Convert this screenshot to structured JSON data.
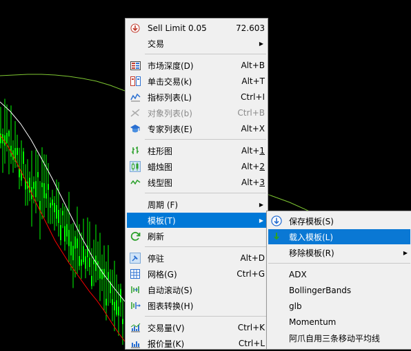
{
  "main_menu": {
    "items": [
      {
        "label": "Sell Limit 0.05",
        "shortcut": "72.603",
        "icon": "sell-limit-icon"
      },
      {
        "label": "交易",
        "submenu": true
      },
      {
        "label": "市场深度(D)",
        "shortcut": "Alt+B",
        "icon": "market-depth-icon"
      },
      {
        "label": "单击交易(k)",
        "shortcut": "Alt+T",
        "icon": "one-click-trading-icon"
      },
      {
        "label": "指标列表(L)",
        "shortcut": "Ctrl+I",
        "icon": "indicators-list-icon"
      },
      {
        "label": "对象列表(b)",
        "shortcut": "Ctrl+B",
        "icon": "objects-list-icon",
        "disabled": true
      },
      {
        "label": "专家列表(E)",
        "shortcut": "Alt+X",
        "icon": "experts-list-icon"
      },
      {
        "label": "柱形图",
        "shortcut_prefix": "Alt+",
        "shortcut_key": "1",
        "icon": "bar-chart-icon"
      },
      {
        "label": "蜡烛图",
        "shortcut_prefix": "Alt+",
        "shortcut_key": "2",
        "icon": "candlestick-icon"
      },
      {
        "label": "线型图",
        "shortcut_prefix": "Alt+",
        "shortcut_key": "3",
        "icon": "line-chart-icon"
      },
      {
        "label": "周期 (F)",
        "submenu": true
      },
      {
        "label": "模板(T)",
        "submenu": true,
        "highlighted": true
      },
      {
        "label": "刷新",
        "icon": "refresh-icon"
      },
      {
        "label": "停驻",
        "shortcut": "Alt+D",
        "icon": "dock-icon"
      },
      {
        "label": "网格(G)",
        "shortcut": "Ctrl+G",
        "icon": "grid-icon"
      },
      {
        "label": "自动滚动(S)",
        "icon": "auto-scroll-icon"
      },
      {
        "label": "图表转换(H)",
        "icon": "chart-shift-icon"
      },
      {
        "label": "交易量(V)",
        "shortcut": "Ctrl+K",
        "icon": "volumes-icon"
      },
      {
        "label": "报价量(K)",
        "shortcut": "Ctrl+L",
        "icon": "tick-volumes-icon"
      }
    ]
  },
  "template_submenu": {
    "items": [
      {
        "label": "保存模板(S)",
        "icon": "save-template-icon"
      },
      {
        "label": "载入模板(L)",
        "icon": "load-template-icon",
        "highlighted": true
      },
      {
        "label": "移除模板(R)",
        "submenu": true
      },
      {
        "label": "ADX"
      },
      {
        "label": "BollingerBands"
      },
      {
        "label": "glb"
      },
      {
        "label": "Momentum"
      },
      {
        "label": "阿爪自用三条移动平均线"
      }
    ]
  },
  "colors": {
    "chart_background": "#000000",
    "candles": "#00ff00",
    "ma_fast": "#ff0000",
    "ma_slow": "#ffffff",
    "ma_long": "#7fc832",
    "menu_background": "#f0f0f0",
    "highlight": "#0078d7"
  }
}
